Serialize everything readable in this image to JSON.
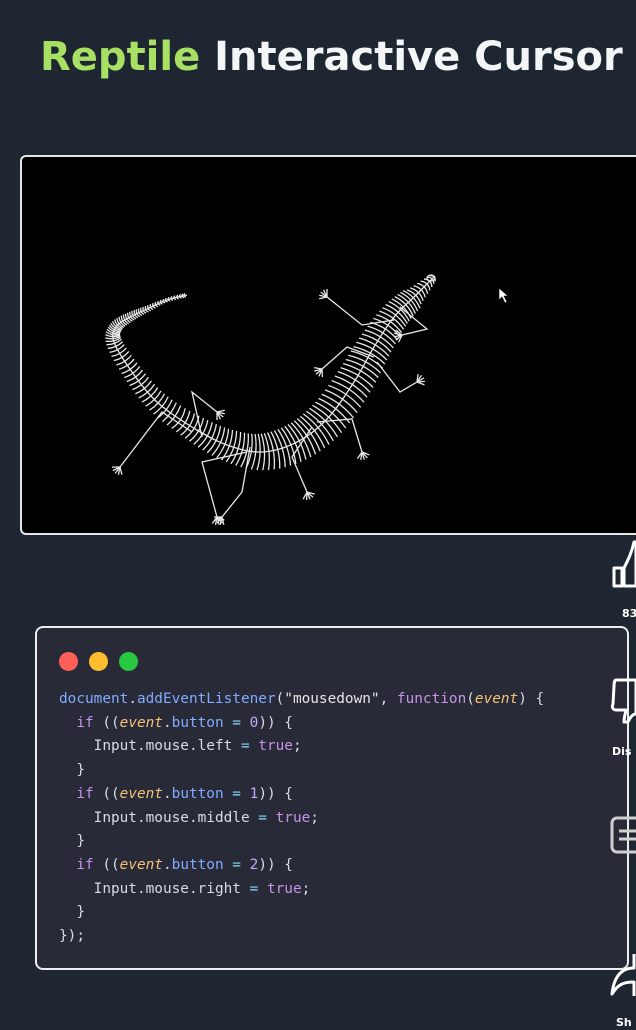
{
  "title": {
    "accent": "Reptile",
    "rest": " Interactive Cursor"
  },
  "code": {
    "window_dots": [
      "#ff5f57",
      "#febc2e",
      "#28c840"
    ],
    "lines": [
      [
        [
          "fn",
          "document"
        ],
        [
          "pl",
          "."
        ],
        [
          "fn",
          "addEventListener"
        ],
        [
          "pl",
          "("
        ],
        [
          "str",
          "\"mousedown\""
        ],
        [
          "pl",
          ", "
        ],
        [
          "kw",
          "function"
        ],
        [
          "pl",
          "("
        ],
        [
          "param",
          "event"
        ],
        [
          "pl",
          ") {"
        ]
      ],
      [
        [
          "pl",
          "  "
        ],
        [
          "kw",
          "if"
        ],
        [
          "pl",
          " (("
        ],
        [
          "param",
          "event"
        ],
        [
          "pl",
          "."
        ],
        [
          "prop",
          "button"
        ],
        [
          "op",
          " = "
        ],
        [
          "num",
          "0"
        ],
        [
          "pl",
          ")) {"
        ]
      ],
      [
        [
          "pl",
          "    Input.mouse.left "
        ],
        [
          "op",
          "="
        ],
        [
          "pl",
          " "
        ],
        [
          "bool",
          "true"
        ],
        [
          "pl",
          ";"
        ]
      ],
      [
        [
          "pl",
          "  }"
        ]
      ],
      [
        [
          "pl",
          "  "
        ],
        [
          "kw",
          "if"
        ],
        [
          "pl",
          " (("
        ],
        [
          "param",
          "event"
        ],
        [
          "pl",
          "."
        ],
        [
          "prop",
          "button"
        ],
        [
          "op",
          " = "
        ],
        [
          "num",
          "1"
        ],
        [
          "pl",
          ")) {"
        ]
      ],
      [
        [
          "pl",
          "    Input.mouse.middle "
        ],
        [
          "op",
          "="
        ],
        [
          "pl",
          " "
        ],
        [
          "bool",
          "true"
        ],
        [
          "pl",
          ";"
        ]
      ],
      [
        [
          "pl",
          "  }"
        ]
      ],
      [
        [
          "pl",
          "  "
        ],
        [
          "kw",
          "if"
        ],
        [
          "pl",
          " (("
        ],
        [
          "param",
          "event"
        ],
        [
          "pl",
          "."
        ],
        [
          "prop",
          "button"
        ],
        [
          "op",
          " = "
        ],
        [
          "num",
          "2"
        ],
        [
          "pl",
          ")) {"
        ]
      ],
      [
        [
          "pl",
          "    Input.mouse.right "
        ],
        [
          "op",
          "="
        ],
        [
          "pl",
          " "
        ],
        [
          "bool",
          "true"
        ],
        [
          "pl",
          ";"
        ]
      ],
      [
        [
          "pl",
          "  }"
        ]
      ],
      [
        [
          "pl",
          "});"
        ]
      ]
    ]
  },
  "sidebar": {
    "like_count": "83",
    "dislike_label": "Dis",
    "share_label": "Sh"
  }
}
